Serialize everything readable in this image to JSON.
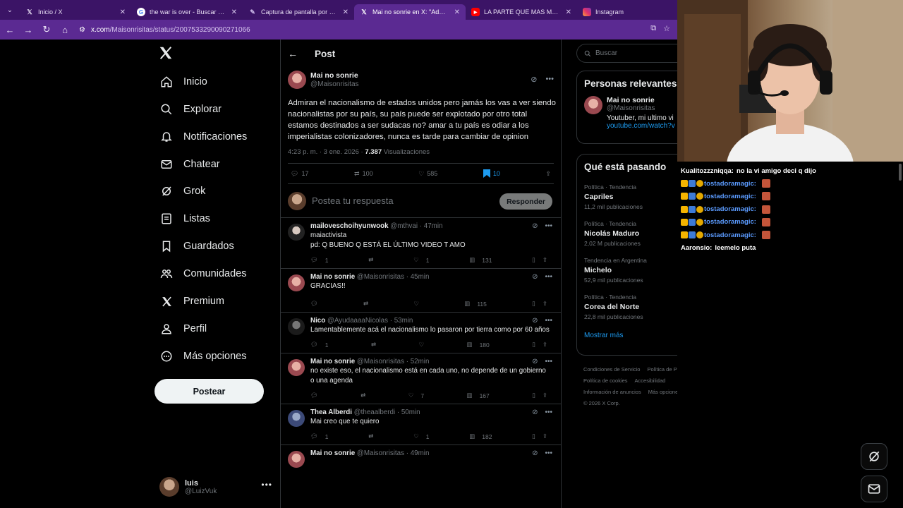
{
  "browser": {
    "tabs": [
      {
        "label": "Inicio / X",
        "icon": "x-logo-icon",
        "active": false
      },
      {
        "label": "the war is over - Buscar con Google",
        "icon": "google-icon",
        "active": false
      },
      {
        "label": "Captura de pantalla por Lightshot",
        "icon": "feather-icon",
        "active": false
      },
      {
        "label": "Mai no sonrie en X: \"Admiran el nacionalismo",
        "icon": "x-logo-icon",
        "active": true
      },
      {
        "label": "LA PARTE QUE MAS ME GUSTA",
        "icon": "youtube-icon",
        "active": false
      },
      {
        "label": "Instagram",
        "icon": "instagram-icon",
        "active": false
      }
    ],
    "url_host": "x.com",
    "url_path": "/Maisonrisitas/status/2007533290090271066"
  },
  "nav": {
    "items": [
      {
        "label": "Inicio",
        "icon": "home-icon"
      },
      {
        "label": "Explorar",
        "icon": "search-icon"
      },
      {
        "label": "Notificaciones",
        "icon": "bell-icon"
      },
      {
        "label": "Chatear",
        "icon": "mail-icon"
      },
      {
        "label": "Grok",
        "icon": "grok-icon"
      },
      {
        "label": "Listas",
        "icon": "list-icon"
      },
      {
        "label": "Guardados",
        "icon": "bookmark-icon"
      },
      {
        "label": "Comunidades",
        "icon": "community-icon"
      },
      {
        "label": "Premium",
        "icon": "x-logo-icon"
      },
      {
        "label": "Perfil",
        "icon": "person-icon"
      },
      {
        "label": "Más opciones",
        "icon": "more-circle-icon"
      }
    ],
    "post_button": "Postear",
    "me": {
      "name": "luis",
      "handle": "@LuizVuk"
    }
  },
  "main": {
    "header": "Post",
    "post": {
      "author": "Mai no sonrie",
      "handle": "@Maisonrisitas",
      "text": "Admiran el nacionalismo de estados unidos pero jamás los vas a ver siendo nacionalistas por su país, su país puede ser explotado por otro total estamos destinados a ser sudacas no? amar a tu país es odiar a los imperialistas colonizadores, nunca es tarde para cambiar de opinion",
      "time": "4:23 p. m. · 3 ene. 2026 · ",
      "views": "7.387",
      "views_label": " Visualizaciones",
      "replies": "17",
      "reposts": "100",
      "likes": "585",
      "bookmarks": "10"
    },
    "reply_placeholder": "Postea tu respuesta",
    "reply_button": "Responder",
    "replies": [
      {
        "name": "mailoveschoihyunwook",
        "handle": "@mthvai · 47min",
        "text": "maiactivista\npd: Q BUENO Q ESTÁ EL ÚLTIMO VIDEO T AMO",
        "replies": "1",
        "reposts": "",
        "likes": "1",
        "views": "131"
      },
      {
        "name": "Mai no sonrie",
        "handle": "@Maisonrisitas · 45min",
        "text": "GRACIAS!!",
        "replies": "",
        "reposts": "",
        "likes": "",
        "views": "115"
      },
      {
        "name": "Nico",
        "handle": "@AyudaaaaNicolas · 53min",
        "text": "Lamentablemente acá el nacionalismo lo pasaron por tierra como por 60 años",
        "replies": "1",
        "reposts": "",
        "likes": "",
        "views": "180"
      },
      {
        "name": "Mai no sonrie",
        "handle": "@Maisonrisitas · 52min",
        "text": "no existe eso, el nacionalismo está en cada uno, no depende de un gobierno o una agenda",
        "replies": "",
        "reposts": "",
        "likes": "7",
        "views": "167"
      },
      {
        "name": "Thea Alberdi",
        "handle": "@theaalberdi · 50min",
        "text": "Mai creo que te quiero",
        "replies": "1",
        "reposts": "",
        "likes": "1",
        "views": "182"
      },
      {
        "name": "Mai no sonrie",
        "handle": "@Maisonrisitas · 49min",
        "text": "",
        "replies": "",
        "reposts": "",
        "likes": "",
        "views": ""
      }
    ]
  },
  "right": {
    "search_placeholder": "Buscar",
    "relevant_title": "Personas relevantes",
    "relevant": {
      "name": "Mai no sonrie",
      "handle": "@Maisonrisitas",
      "bio": "Youtuber, mi ultimo vi",
      "link": "youtube.com/watch?v"
    },
    "trends_title": "Qué está pasando",
    "trends": [
      {
        "category": "Política · Tendencia",
        "name": "Capriles",
        "count": "11,2 mil publicaciones"
      },
      {
        "category": "Política · Tendencia",
        "name": "Nicolás Maduro",
        "count": "2,02 M publicaciones"
      },
      {
        "category": "Tendencia en Argentina",
        "name": "Michelo",
        "count": "52,9 mil publicaciones"
      },
      {
        "category": "Política · Tendencia",
        "name": "Corea del Norte",
        "count": "22,8 mil publicaciones"
      }
    ],
    "show_more": "Mostrar más",
    "footer": [
      "Condiciones de Servicio",
      "Política de Privacidad",
      "Política de cookies",
      "Accesibilidad",
      "Información de anuncios",
      "Más opciones ···",
      "© 2026 X Corp."
    ]
  },
  "chat": {
    "lines": [
      {
        "user": "Kualitozzzniqqa:",
        "text": "no la vi amigo deci q dijo",
        "color": "#ffffff"
      },
      {
        "user": "tostadoramagic:",
        "text": "",
        "color": "#5b9bff"
      },
      {
        "user": "tostadoramagic:",
        "text": "",
        "color": "#5b9bff"
      },
      {
        "user": "tostadoramagic:",
        "text": "",
        "color": "#5b9bff"
      },
      {
        "user": "tostadoramagic:",
        "text": "",
        "color": "#5b9bff"
      },
      {
        "user": "tostadoramagic:",
        "text": "",
        "color": "#5b9bff"
      },
      {
        "user": "Aaronsio:",
        "text": "leemelo puta",
        "color": "#ffffff"
      }
    ]
  },
  "colors": {
    "accent": "#1d9bf0",
    "chrome": "#5b2a92",
    "tabbar": "#3b1466"
  }
}
